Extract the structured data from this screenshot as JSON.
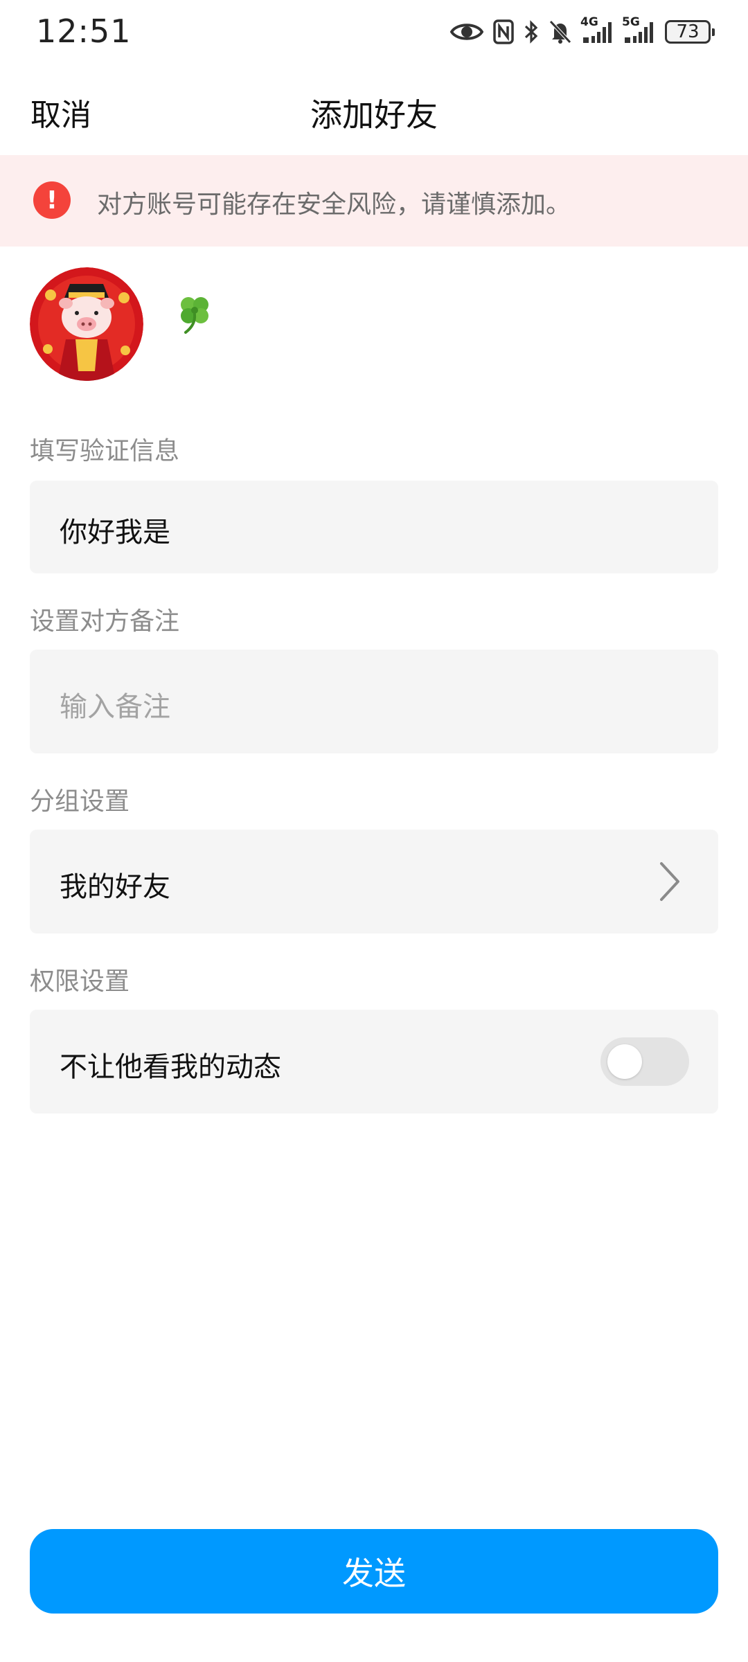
{
  "status_bar": {
    "time": "12:51",
    "net_4g": "4G",
    "net_5g": "5G",
    "battery": "73",
    "icons": [
      "eye-icon",
      "nfc-icon",
      "bluetooth-icon",
      "bell-off-icon",
      "signal-4g-icon",
      "signal-5g-icon",
      "battery-icon"
    ]
  },
  "header": {
    "cancel_label": "取消",
    "title": "添加好友"
  },
  "warning": {
    "icon": "!",
    "text": "对方账号可能存在安全风险，请谨慎添加。",
    "color": "#f4433b"
  },
  "profile": {
    "avatar_icon": "pig-avatar",
    "decoration_icon": "four-leaf-clover-icon"
  },
  "verification": {
    "label": "填写验证信息",
    "value": "你好我是"
  },
  "remark": {
    "label": "设置对方备注",
    "placeholder": "输入备注"
  },
  "group": {
    "label": "分组设置",
    "value": "我的好友"
  },
  "permission": {
    "label": "权限设置",
    "option_label": "不让他看我的动态",
    "enabled": false
  },
  "send_button": {
    "label": "发送",
    "color": "#0099ff"
  }
}
